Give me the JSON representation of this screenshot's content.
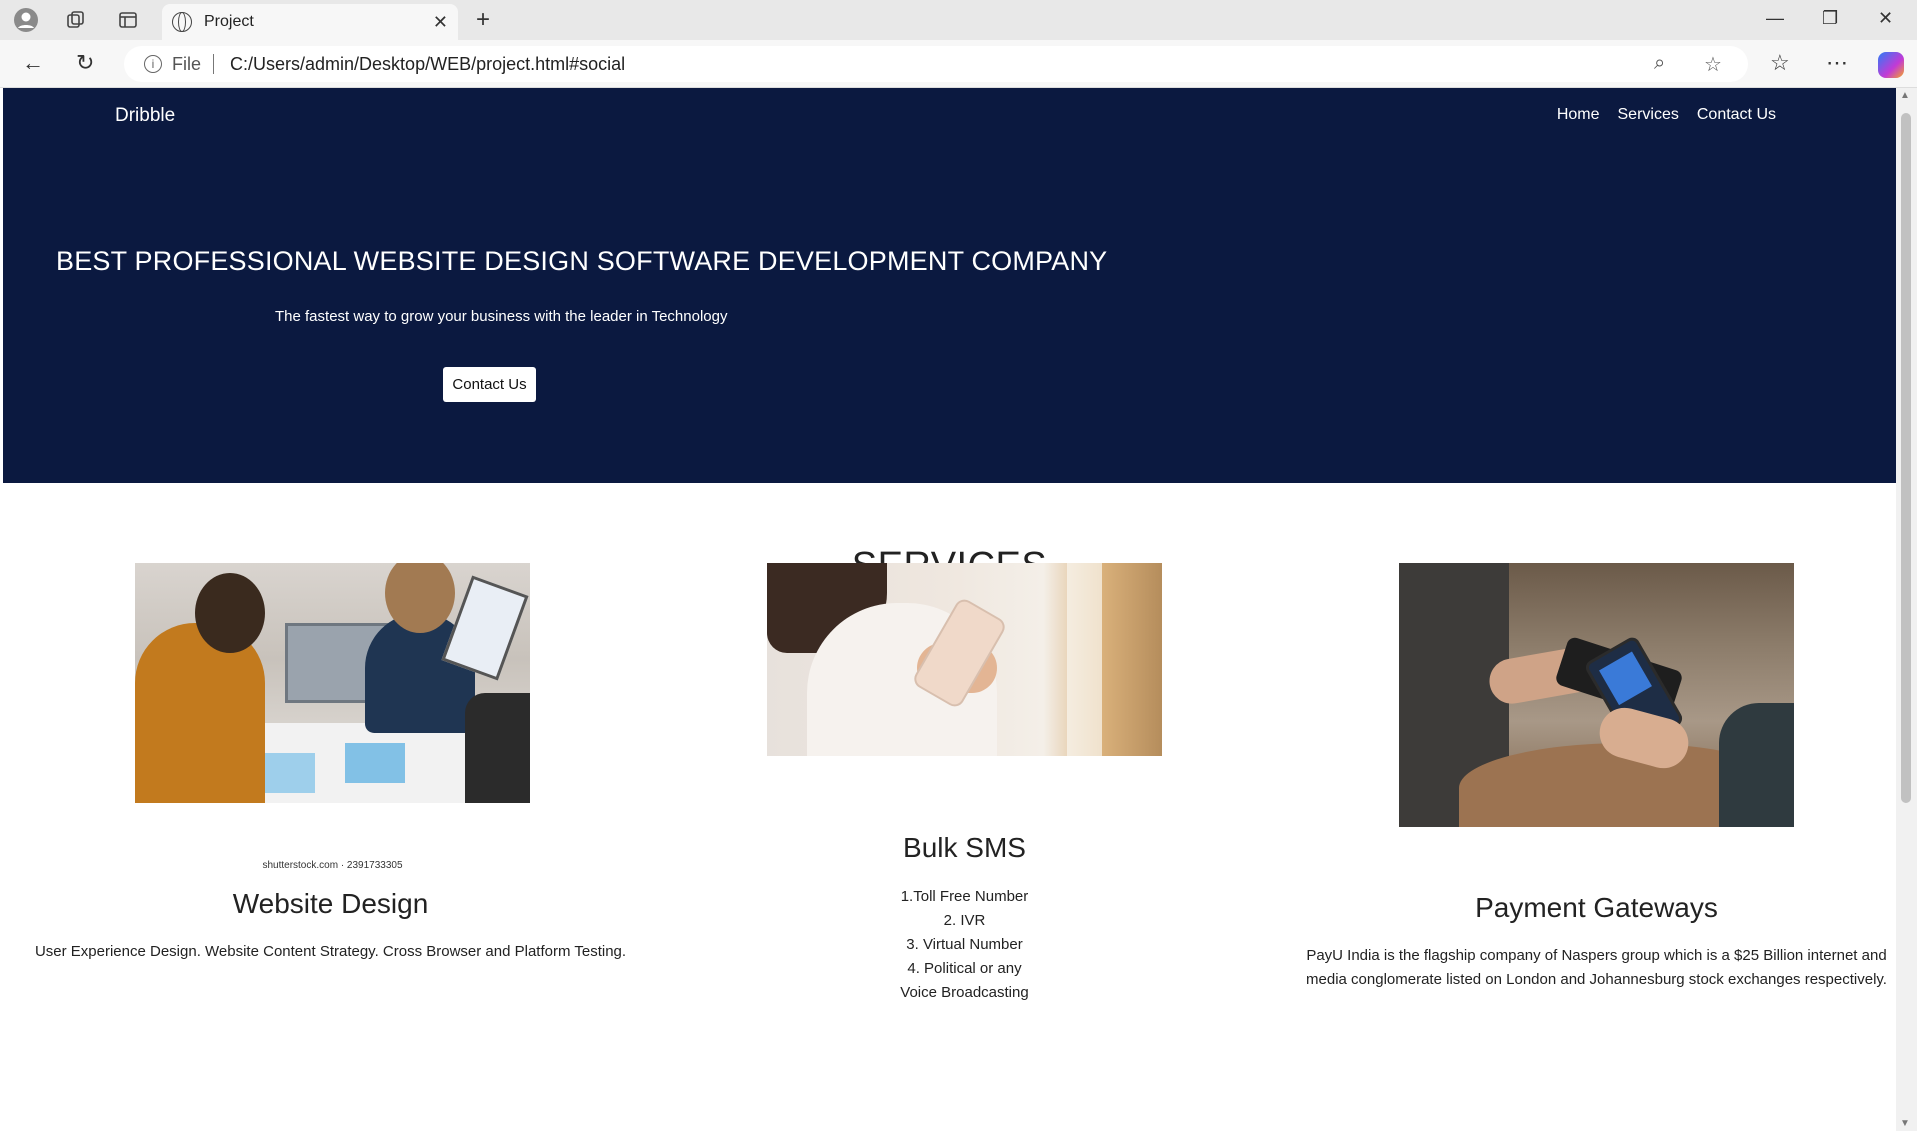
{
  "browser": {
    "tab_title": "Project",
    "address_prefix": "File",
    "url": "C:/Users/admin/Desktop/WEB/project.html#social"
  },
  "site": {
    "brand": "Dribble",
    "nav": [
      "Home",
      "Services",
      "Contact Us"
    ]
  },
  "hero": {
    "heading": "BEST PROFESSIONAL WEBSITE DESIGN SOFTWARE DEVELOPMENT COMPANY",
    "subheading": "The fastest way to grow your business with the leader in Technology",
    "cta_label": "Contact Us"
  },
  "services": {
    "title": "SERVICES",
    "cards": [
      {
        "title": "Website Design",
        "image_watermark": "shutterstock.com · 2391733305",
        "text": "User Experience Design. Website Content Strategy. Cross Browser and Platform Testing."
      },
      {
        "title": "Bulk SMS",
        "lines": [
          "1.Toll Free Number",
          "2. IVR",
          "3. Virtual Number",
          "4. Political or any",
          "Voice Broadcasting"
        ]
      },
      {
        "title": "Payment Gateways",
        "text_line1": "PayU India is the flagship company of Naspers group which is a $25 Billion internet and",
        "text_line2": "media conglomerate listed on London and Johannesburg stock exchanges respectively."
      }
    ]
  },
  "colors": {
    "hero_bg": "#0b1940",
    "hero_text": "#ffffff"
  }
}
